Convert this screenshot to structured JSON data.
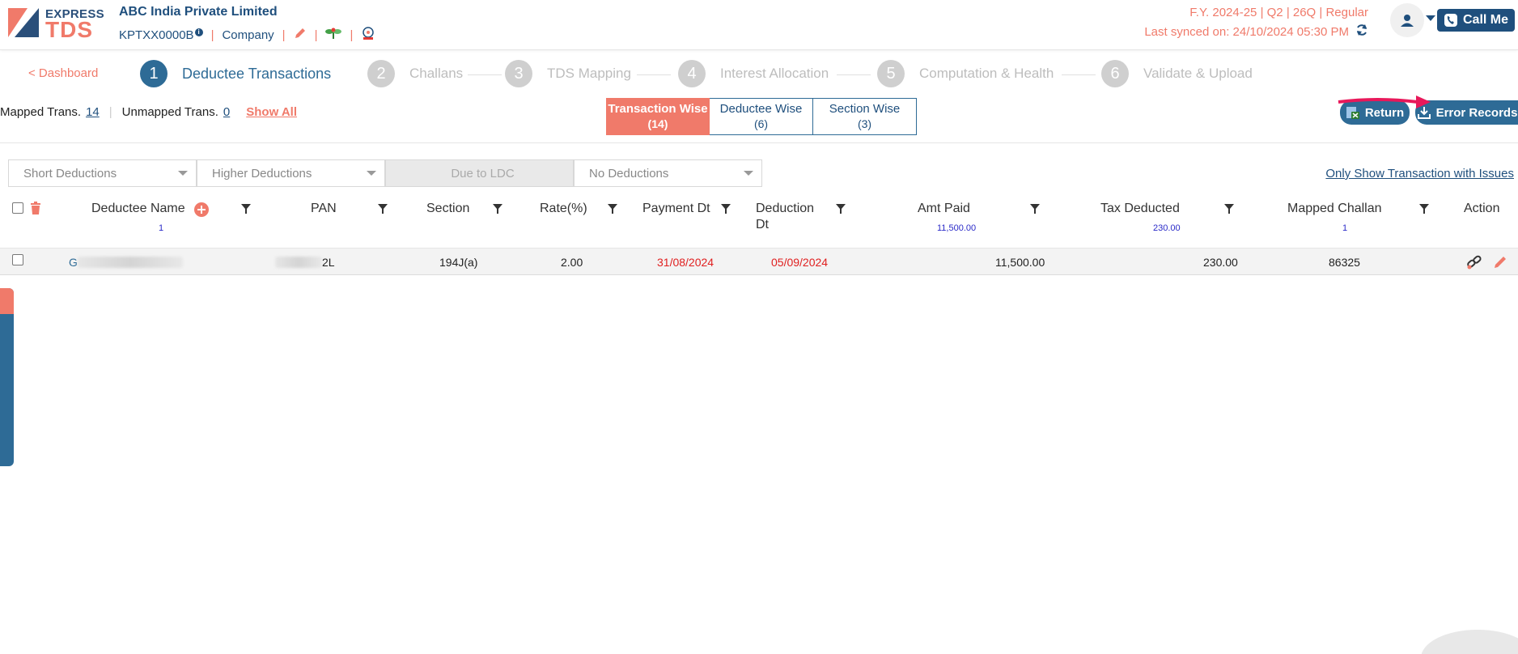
{
  "header": {
    "logo_top": "EXPRESS",
    "logo_bottom": "TDS",
    "company_name": "ABC India Private Limited",
    "tan": "KPTXX0000B",
    "info_badge": "i",
    "entity_type": "Company",
    "fy_info": "F.Y. 2024-25  | Q2  | 26Q | Regular",
    "last_synced": "Last synced on: 24/10/2024 05:30 PM",
    "call_me": "Call Me"
  },
  "nav": {
    "dashboard_link": "< Dashboard",
    "steps": [
      {
        "num": "1",
        "label": "Deductee Transactions",
        "active": true
      },
      {
        "num": "2",
        "label": "Challans",
        "active": false
      },
      {
        "num": "3",
        "label": "TDS Mapping",
        "active": false
      },
      {
        "num": "4",
        "label": "Interest Allocation",
        "active": false
      },
      {
        "num": "5",
        "label": "Computation & Health",
        "active": false
      },
      {
        "num": "6",
        "label": "Validate & Upload",
        "active": false
      }
    ]
  },
  "summary": {
    "mapped_label": "Mapped Trans.",
    "mapped_count": "14",
    "unmapped_label": "Unmapped Trans.",
    "unmapped_count": "0",
    "show_all": "Show All"
  },
  "view_tabs": [
    {
      "label": "Transaction Wise",
      "count": "(14)",
      "active": true
    },
    {
      "label": "Deductee Wise",
      "count": "(6)",
      "active": false
    },
    {
      "label": "Section Wise",
      "count": "(3)",
      "active": false
    }
  ],
  "actions": {
    "return_label": "Return",
    "error_records_label": "Error Records"
  },
  "filters": [
    {
      "label": "Short Deductions",
      "disabled": false
    },
    {
      "label": "Higher Deductions",
      "disabled": false
    },
    {
      "label": "Due to LDC",
      "disabled": true
    },
    {
      "label": "No Deductions",
      "disabled": false
    }
  ],
  "issues_link": "Only Show Transaction with Issues",
  "table": {
    "columns": {
      "deductee_name": "Deductee Name",
      "deductee_count": "1",
      "pan": "PAN",
      "section": "Section",
      "rate": "Rate(%)",
      "payment_dt": "Payment Dt",
      "deduction_dt_1": "Deduction",
      "deduction_dt_2": "Dt",
      "amt_paid": "Amt Paid",
      "amt_paid_total": "11,500.00",
      "tax_deducted": "Tax Deducted",
      "tax_deducted_total": "230.00",
      "mapped_challan": "Mapped Challan",
      "mapped_challan_count": "1",
      "action": "Action"
    },
    "rows": [
      {
        "deductee_name_prefix": "G",
        "pan_suffix": "2L",
        "section": "194J(a)",
        "rate": "2.00",
        "payment_dt": "31/08/2024",
        "deduction_dt": "05/09/2024",
        "amt_paid": "11,500.00",
        "tax_deducted": "230.00",
        "mapped_challan": "86325"
      }
    ]
  },
  "colors": {
    "primary": "#2e6b96",
    "accent": "#f07a6a",
    "danger": "#e02020"
  }
}
